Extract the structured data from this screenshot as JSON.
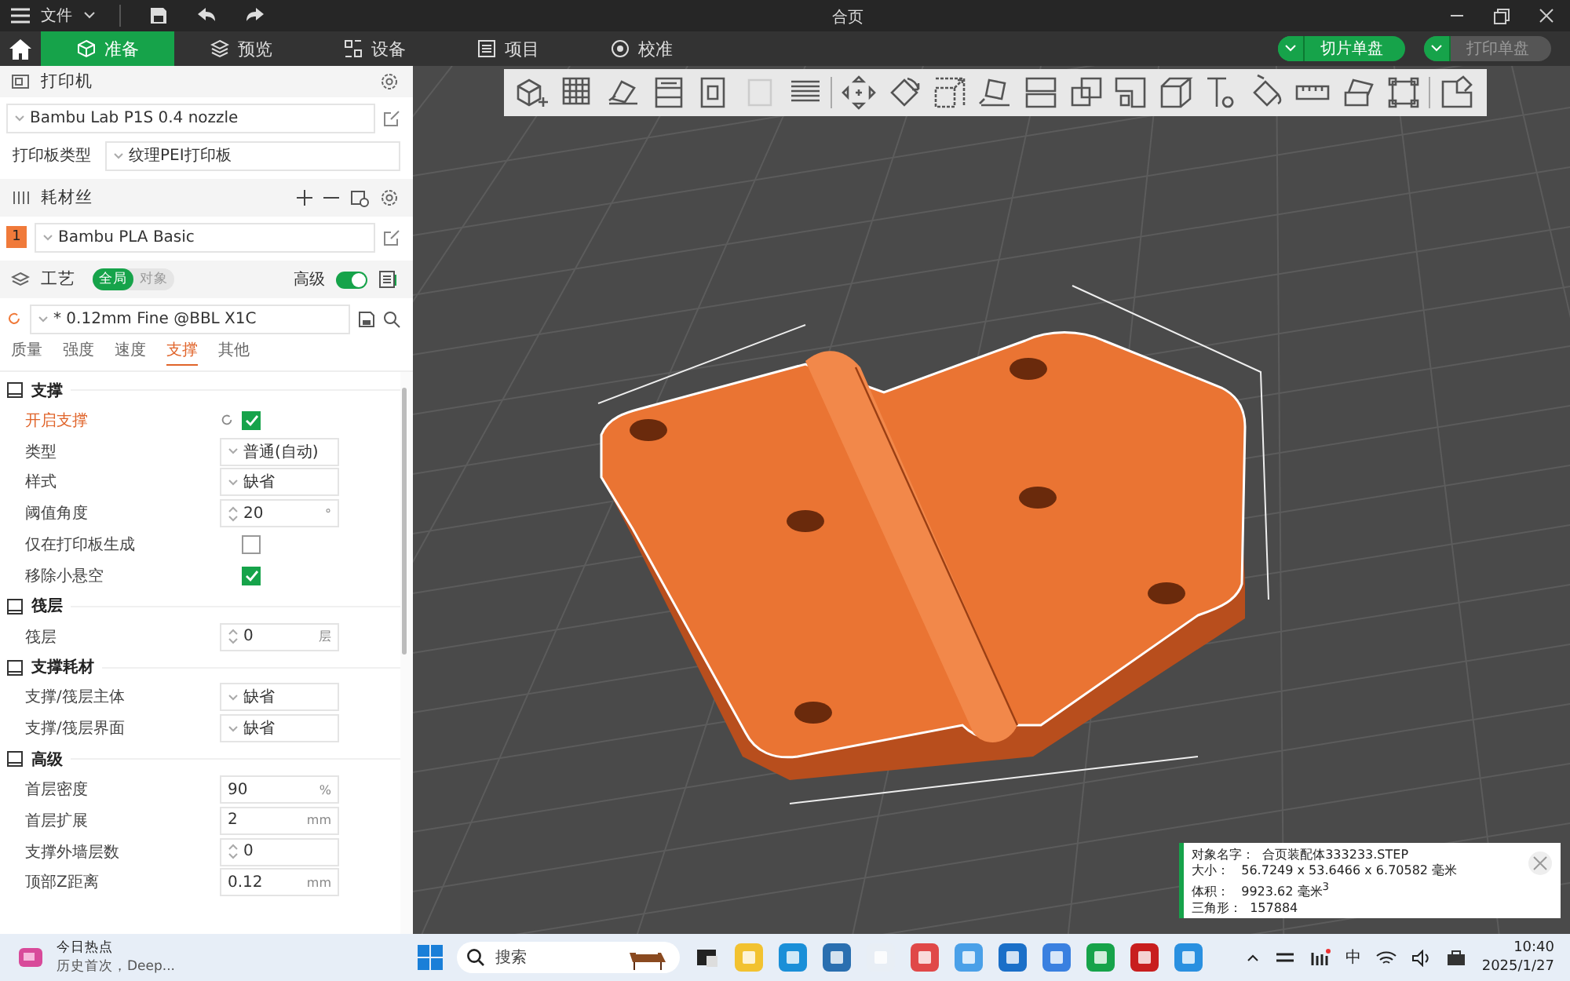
{
  "title_bar": {
    "menu": "文件",
    "title": "合页"
  },
  "tabs": [
    {
      "label": "准备",
      "selected": true
    },
    {
      "label": "预览",
      "selected": false
    },
    {
      "label": "设备",
      "selected": false
    },
    {
      "label": "项目",
      "selected": false
    },
    {
      "label": "校准",
      "selected": false
    }
  ],
  "actions": [
    {
      "label": "切片单盘",
      "disabled": false
    },
    {
      "label": "打印单盘",
      "disabled": true
    }
  ],
  "printer": {
    "header": "打印机",
    "preset": "Bambu Lab P1S 0.4 nozzle",
    "plate_label": "打印板类型",
    "plate": "纹理PEI打印板"
  },
  "filament": {
    "header": "耗材丝",
    "items": [
      {
        "index": "1",
        "name": "Bambu PLA Basic",
        "color": "#f07a3a"
      }
    ]
  },
  "process": {
    "header": "工艺",
    "scopes": [
      {
        "label": "全局",
        "selected": true
      },
      {
        "label": "对象",
        "selected": false
      }
    ],
    "advanced_label": "高级",
    "advanced": true,
    "preset": "* 0.12mm Fine @BBL X1C"
  },
  "setting_tabs": [
    {
      "label": "质量",
      "selected": false
    },
    {
      "label": "强度",
      "selected": false
    },
    {
      "label": "速度",
      "selected": false
    },
    {
      "label": "支撑",
      "selected": true
    },
    {
      "label": "其他",
      "selected": false
    }
  ],
  "sections": [
    {
      "title": "支撑",
      "rows": [
        {
          "label": "开启支撑",
          "kind": "checkbox",
          "checked": true,
          "modified": true
        },
        {
          "label": "类型",
          "kind": "select",
          "value": "普通(自动)",
          "modified": false
        },
        {
          "label": "样式",
          "kind": "select",
          "value": "缺省",
          "modified": false
        },
        {
          "label": "阈值角度",
          "kind": "spin",
          "value": "20",
          "unit": "°",
          "modified": false
        },
        {
          "label": "仅在打印板生成",
          "kind": "checkbox",
          "checked": false,
          "modified": false
        },
        {
          "label": "移除小悬空",
          "kind": "checkbox",
          "checked": true,
          "modified": false
        }
      ]
    },
    {
      "title": "筏层",
      "rows": [
        {
          "label": "筏层",
          "kind": "spin",
          "value": "0",
          "unit": "层",
          "modified": false
        }
      ]
    },
    {
      "title": "支撑耗材",
      "rows": [
        {
          "label": "支撑/筏层主体",
          "kind": "select",
          "value": "缺省",
          "modified": false
        },
        {
          "label": "支撑/筏层界面",
          "kind": "select",
          "value": "缺省",
          "modified": false
        }
      ]
    },
    {
      "title": "高级",
      "rows": [
        {
          "label": "首层密度",
          "kind": "input",
          "value": "90",
          "unit": "%",
          "modified": false
        },
        {
          "label": "首层扩展",
          "kind": "input",
          "value": "2",
          "unit": "mm",
          "modified": false
        },
        {
          "label": "支撑外墙层数",
          "kind": "spin",
          "value": "0",
          "modified": false
        },
        {
          "label": "顶部Z距离",
          "kind": "input",
          "value": "0.12",
          "unit": "mm",
          "modified": false
        }
      ]
    }
  ],
  "info": {
    "lines": [
      "对象名字：  合页装配体333233.STEP",
      "大小：   56.7249 x 53.6466 x 6.70582 毫米",
      "体积：   9923.62 毫米$^{3}$",
      "三角形：  157884"
    ]
  },
  "taskbar": {
    "news_title": "今日热点",
    "news_text": "历史首次，Deep...",
    "search": "搜索",
    "ime": "中",
    "time": "10:40",
    "date": "2025/1/27"
  }
}
